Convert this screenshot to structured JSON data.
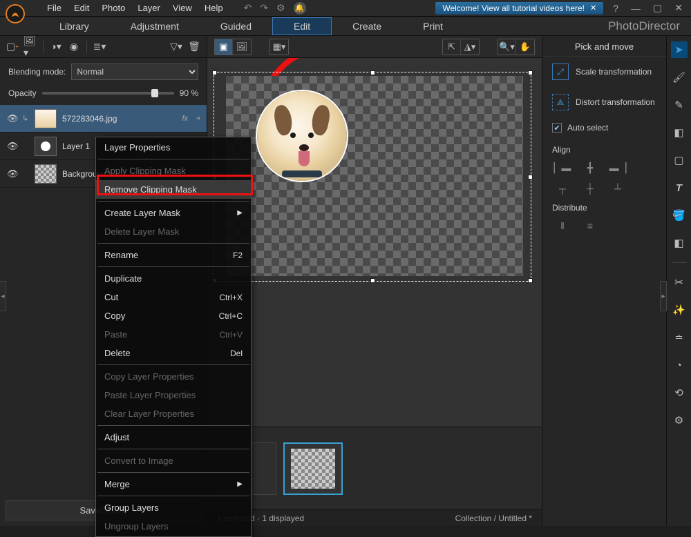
{
  "menubar": {
    "items": [
      "File",
      "Edit",
      "Photo",
      "Layer",
      "View",
      "Help"
    ],
    "welcome": "Welcome! View all tutorial videos here!"
  },
  "tabs": {
    "items": [
      "Library",
      "Adjustment",
      "Guided",
      "Edit",
      "Create",
      "Print"
    ],
    "active": 3,
    "brand": "PhotoDirector"
  },
  "left": {
    "blending_mode_label": "Blending mode:",
    "blending_mode_value": "Normal",
    "opacity_label": "Opacity",
    "opacity_value": "90 %",
    "layers": [
      {
        "name": "572283046.jpg",
        "fx": "fx",
        "clipped": true
      },
      {
        "name": "Layer 1"
      },
      {
        "name": "Background"
      }
    ],
    "save": "Save/Share"
  },
  "context": {
    "items": [
      {
        "t": "Layer Properties"
      },
      "sep",
      {
        "t": "Apply Clipping Mask",
        "disabled": true
      },
      {
        "t": "Remove Clipping Mask",
        "selected": true
      },
      "sep",
      {
        "t": "Create Layer Mask",
        "sub": true
      },
      {
        "t": "Delete Layer Mask",
        "disabled": true
      },
      "sep",
      {
        "t": "Rename",
        "shortcut": "F2"
      },
      "sep",
      {
        "t": "Duplicate"
      },
      {
        "t": "Cut",
        "shortcut": "Ctrl+X"
      },
      {
        "t": "Copy",
        "shortcut": "Ctrl+C"
      },
      {
        "t": "Paste",
        "shortcut": "Ctrl+V",
        "disabled": true
      },
      {
        "t": "Delete",
        "shortcut": "Del"
      },
      "sep",
      {
        "t": "Copy Layer Properties",
        "disabled": true
      },
      {
        "t": "Paste Layer Properties",
        "disabled": true
      },
      {
        "t": "Clear Layer Properties",
        "disabled": true
      },
      "sep",
      {
        "t": "Adjust"
      },
      "sep",
      {
        "t": "Convert to Image",
        "disabled": true
      },
      "sep",
      {
        "t": "Merge",
        "sub": true
      },
      "sep",
      {
        "t": "Group Layers"
      },
      {
        "t": "Ungroup Layers",
        "disabled": true
      }
    ]
  },
  "status": {
    "left": "1 selected · 1 displayed",
    "right": "Collection / Untitled *"
  },
  "right": {
    "heading": "Pick and move",
    "scale": "Scale transformation",
    "distort": "Distort transformation",
    "autoselect": "Auto select",
    "align": "Align",
    "distribute": "Distribute"
  }
}
